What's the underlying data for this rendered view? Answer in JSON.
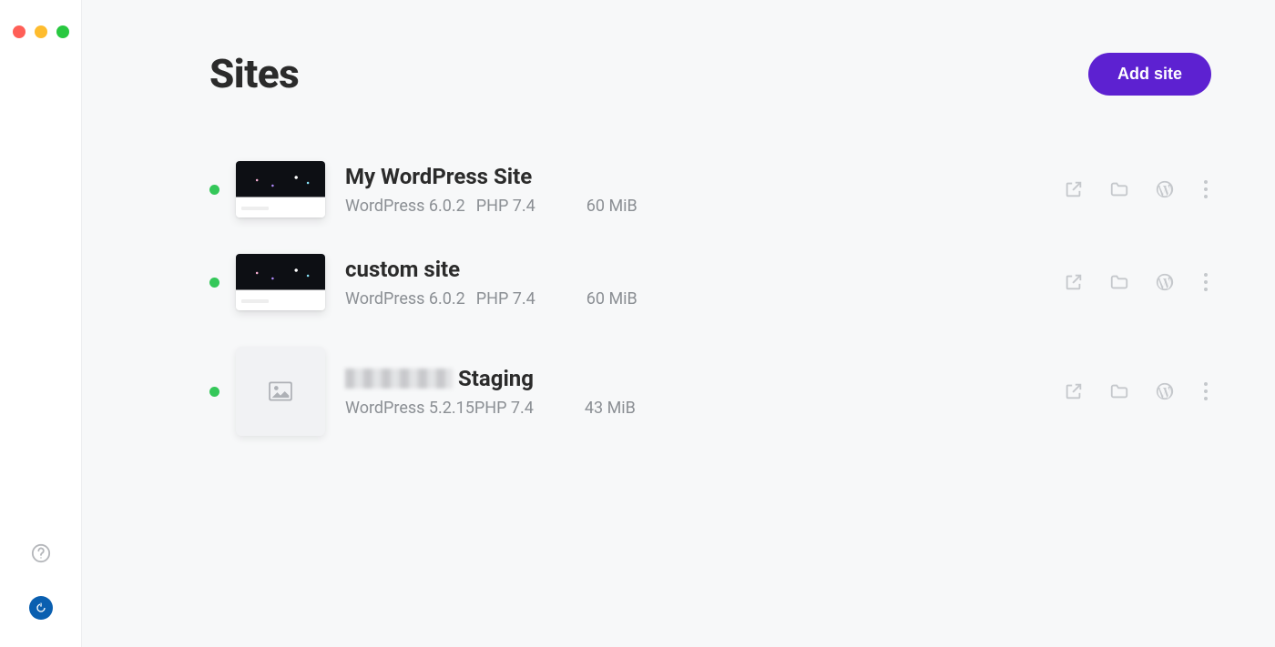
{
  "header": {
    "title": "Sites",
    "add_button": "Add site"
  },
  "sites": [
    {
      "name": "My WordPress Site",
      "name_blurred": "",
      "wp_version": "WordPress 6.0.2",
      "php_version": "PHP 7.4",
      "size": "60 MiB",
      "status": "running",
      "thumb": "dark"
    },
    {
      "name": "custom site",
      "name_blurred": "",
      "wp_version": "WordPress 6.0.2",
      "php_version": "PHP 7.4",
      "size": "60 MiB",
      "status": "running",
      "thumb": "dark"
    },
    {
      "name": "Staging",
      "name_blurred": "redacted",
      "wp_version": "WordPress 5.2.15",
      "php_version": "PHP 7.4",
      "size": "43 MiB",
      "status": "running",
      "thumb": "placeholder"
    }
  ],
  "icons": {
    "open_external": "open-in-browser",
    "folder": "reveal-folder",
    "wp_admin": "wp-admin",
    "more": "more-options",
    "help": "help",
    "app_logo": "app-logo"
  },
  "window_controls": {
    "close": "close-window",
    "minimize": "minimize-window",
    "zoom": "zoom-window"
  }
}
